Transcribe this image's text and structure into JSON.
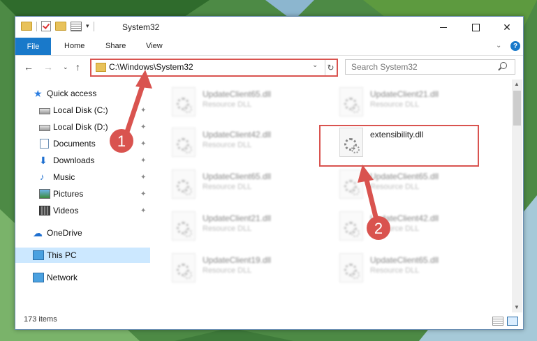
{
  "window": {
    "title": "System32",
    "controls": {
      "minimize": "",
      "maximize": "",
      "close": "✕"
    }
  },
  "quick_access_toolbar": {
    "icons": [
      "folder-icon",
      "properties-check-icon",
      "new-folder-icon",
      "properties-icon",
      "dropdown-icon"
    ]
  },
  "ribbon": {
    "tabs": [
      "File",
      "Home",
      "Share",
      "View"
    ],
    "expand_chevron": "⌄",
    "help": "?"
  },
  "navigation": {
    "back": "←",
    "forward": "→",
    "recent": "⌄",
    "up": "↑",
    "address": "C:\\Windows\\System32",
    "address_dropdown": "⌄",
    "refresh": "↻",
    "search_placeholder": "Search System32"
  },
  "sidebar": {
    "quick_access": "Quick access",
    "items": [
      {
        "label": "Local Disk (C:)",
        "icon": "drive-icon",
        "pinned": true
      },
      {
        "label": "Local Disk (D:)",
        "icon": "drive-icon",
        "pinned": true
      },
      {
        "label": "Documents",
        "icon": "documents-icon",
        "pinned": true
      },
      {
        "label": "Downloads",
        "icon": "downloads-icon",
        "pinned": true
      },
      {
        "label": "Music",
        "icon": "music-icon",
        "pinned": true
      },
      {
        "label": "Pictures",
        "icon": "pictures-icon",
        "pinned": true
      },
      {
        "label": "Videos",
        "icon": "videos-icon",
        "pinned": true
      }
    ],
    "onedrive": "OneDrive",
    "this_pc": "This PC",
    "network": "Network",
    "pin_glyph": "📌"
  },
  "files": {
    "left_column": [
      {
        "name": "UpdateClient65.dll",
        "type": "Resource DLL"
      },
      {
        "name": "UpdateClient42.dll",
        "type": "Resource DLL"
      },
      {
        "name": "UpdateClient65.dll",
        "type": "Resource DLL"
      },
      {
        "name": "UpdateClient21.dll",
        "type": "Resource DLL"
      },
      {
        "name": "UpdateClient19.dll",
        "type": "Resource DLL"
      }
    ],
    "right_column": [
      {
        "name": "UpdateClient21.dll",
        "type": "Resource DLL"
      },
      {
        "name": "extensibility.dll",
        "type": ""
      },
      {
        "name": "UpdateClient65.dll",
        "type": "Resource DLL"
      },
      {
        "name": "UpdateClient42.dll",
        "type": "Resource DLL"
      },
      {
        "name": "UpdateClient65.dll",
        "type": "Resource DLL"
      }
    ]
  },
  "status": {
    "item_count": "173 items"
  },
  "annotations": {
    "step1": "1",
    "step2": "2",
    "color": "#d9534f"
  },
  "colors": {
    "accent": "#1979ca",
    "selection": "#cce8ff",
    "highlight": "#d9534f"
  }
}
